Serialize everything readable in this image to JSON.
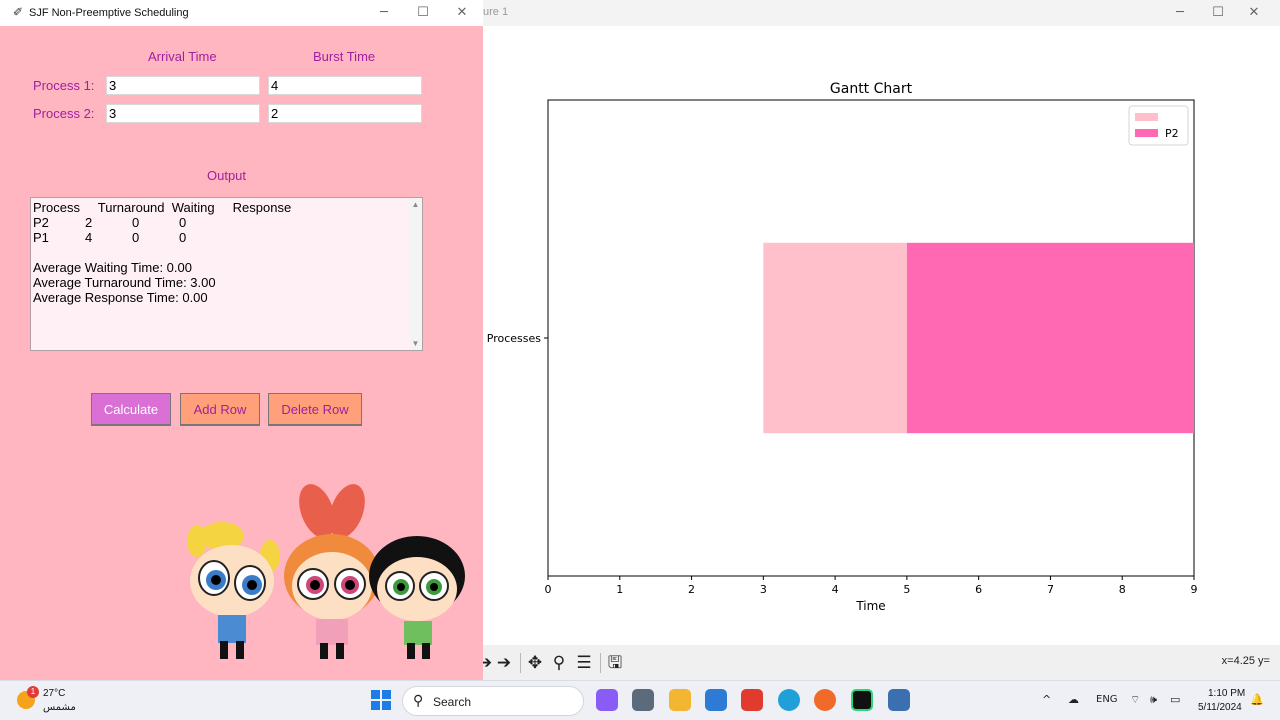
{
  "app": {
    "title": "SJF Non-Preemptive Scheduling",
    "headers": {
      "arrival": "Arrival Time",
      "burst": "Burst Time"
    },
    "processes": [
      {
        "label": "Process 1:",
        "arrival": "3",
        "burst": "4"
      },
      {
        "label": "Process 2:",
        "arrival": "3",
        "burst": "2"
      }
    ],
    "output_label": "Output",
    "output_text": "Process     Turnaround  Waiting     Response\nP2          2           0           0\nP1          4           0           0\n\nAverage Waiting Time: 0.00\nAverage Turnaround Time: 3.00\nAverage Response Time: 0.00",
    "buttons": {
      "calculate": "Calculate",
      "add_row": "Add Row",
      "delete_row": "Delete Row"
    }
  },
  "figure": {
    "window_title": "ure 1",
    "coord_readout": "x=4.25 y=",
    "toolbar_icons": [
      "back-icon",
      "forward-icon",
      "pan-icon",
      "zoom-icon",
      "configure-icon",
      "save-icon"
    ]
  },
  "chart_data": {
    "type": "bar",
    "title": "Gantt Chart",
    "xlabel": "Time",
    "ylabel": "",
    "categories": [
      "Processes"
    ],
    "xlim": [
      0,
      9
    ],
    "xticks": [
      "0",
      "1",
      "2",
      "3",
      "4",
      "5",
      "6",
      "7",
      "8",
      "9"
    ],
    "series": [
      {
        "name": "",
        "start": 3,
        "duration": 2,
        "color": "#ffc0cb"
      },
      {
        "name": "P2",
        "start": 5,
        "duration": 4,
        "color": "#ff69b4"
      }
    ],
    "legend": "top-right",
    "grid": false
  },
  "taskbar": {
    "temperature": "27°C",
    "weather_label": "مشمس",
    "weather_badge": "1",
    "search_label": "Search",
    "language": "ENG",
    "time": "1:10 PM",
    "date": "5/11/2024"
  },
  "colors": {
    "app_background": "#ffb6c1",
    "label_purple": "#a020a0",
    "calculate_button": "#da70d6",
    "orange_button": "#ffa07a"
  }
}
